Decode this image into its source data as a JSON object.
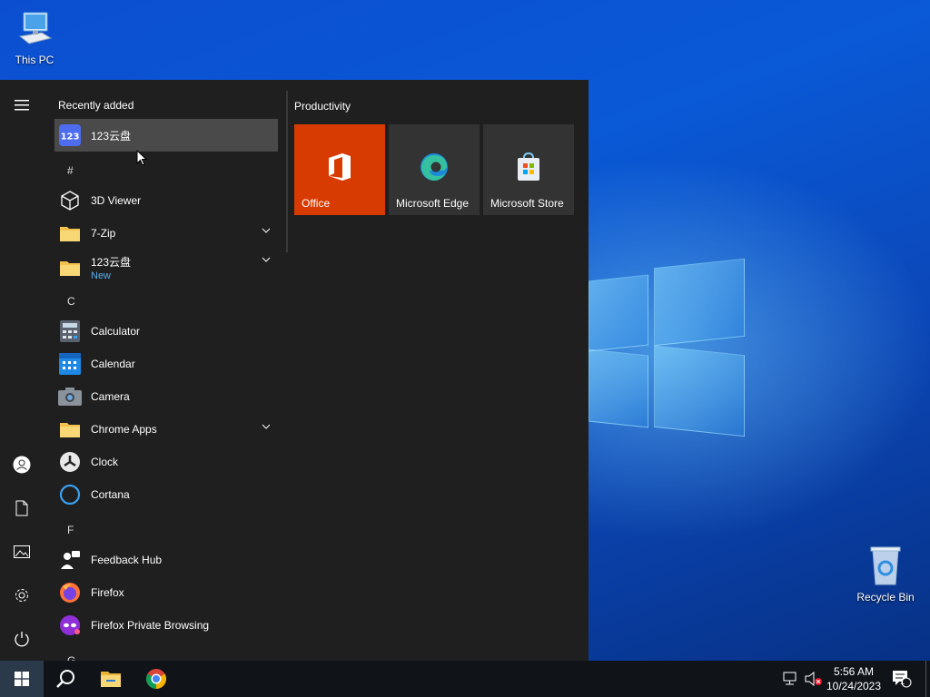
{
  "desktop": {
    "icons": [
      {
        "label": "This PC",
        "icon": "computer-icon"
      },
      {
        "label": "Recycle Bin",
        "icon": "recycle-bin-icon"
      }
    ]
  },
  "start_menu": {
    "rail": [
      "hamburger-menu-icon",
      "user-icon",
      "documents-icon",
      "pictures-icon",
      "settings-icon",
      "power-icon"
    ],
    "recently_added_header": "Recently added",
    "recent_app": "123云盘",
    "sections": {
      "hash": "#",
      "c": "C",
      "f": "F",
      "g": "G"
    },
    "apps": {
      "viewer3d": "3D Viewer",
      "zip": "7-Zip",
      "yunpan": "123云盘",
      "yunpan_badge": "New",
      "calculator": "Calculator",
      "calendar": "Calendar",
      "camera": "Camera",
      "chrome_apps": "Chrome Apps",
      "clock": "Clock",
      "cortana": "Cortana",
      "feedback": "Feedback Hub",
      "firefox": "Firefox",
      "firefox_private": "Firefox Private Browsing"
    },
    "tiles_group": "Productivity",
    "tiles": {
      "office": "Office",
      "edge": "Microsoft Edge",
      "store": "Microsoft Store"
    },
    "colors": {
      "office_tile": "#d83b01",
      "tile": "#333333",
      "accent_new": "#5ab0f0"
    }
  },
  "taskbar": {
    "time": "5:56 AM",
    "date": "10/24/2023",
    "notification_count": "1",
    "items": [
      "windows-start-icon",
      "search-icon",
      "file-explorer-icon",
      "chrome-icon"
    ]
  }
}
